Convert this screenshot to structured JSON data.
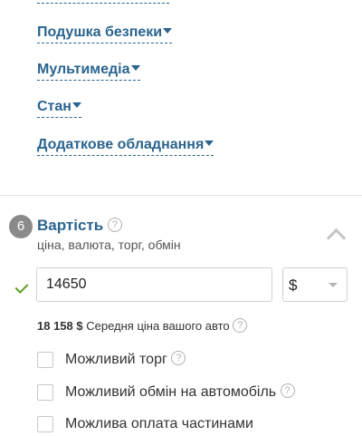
{
  "options": {
    "items": [
      {
        "label": "Подушка безпеки"
      },
      {
        "label": "Мультимедіа"
      },
      {
        "label": "Стан"
      },
      {
        "label": "Додаткове обладнання"
      }
    ]
  },
  "section": {
    "step": "6",
    "title": "Вартість",
    "help": "?",
    "subtitle": "ціна, валюта, торг, обмін"
  },
  "price": {
    "value": "14650",
    "currency": "$"
  },
  "average": {
    "amount": "18 158 $",
    "text": "Середня ціна вашого авто",
    "help": "?"
  },
  "checkboxes": [
    {
      "label": "Можливий торг",
      "checked": false,
      "help": "?"
    },
    {
      "label": "Можливий обмін на автомобіль",
      "checked": false,
      "help": "?"
    },
    {
      "label": "Можлива оплата частинами",
      "checked": false
    }
  ],
  "colors": {
    "link": "#2a648f",
    "badge": "#8a8a8a",
    "valid": "#5aa020"
  }
}
